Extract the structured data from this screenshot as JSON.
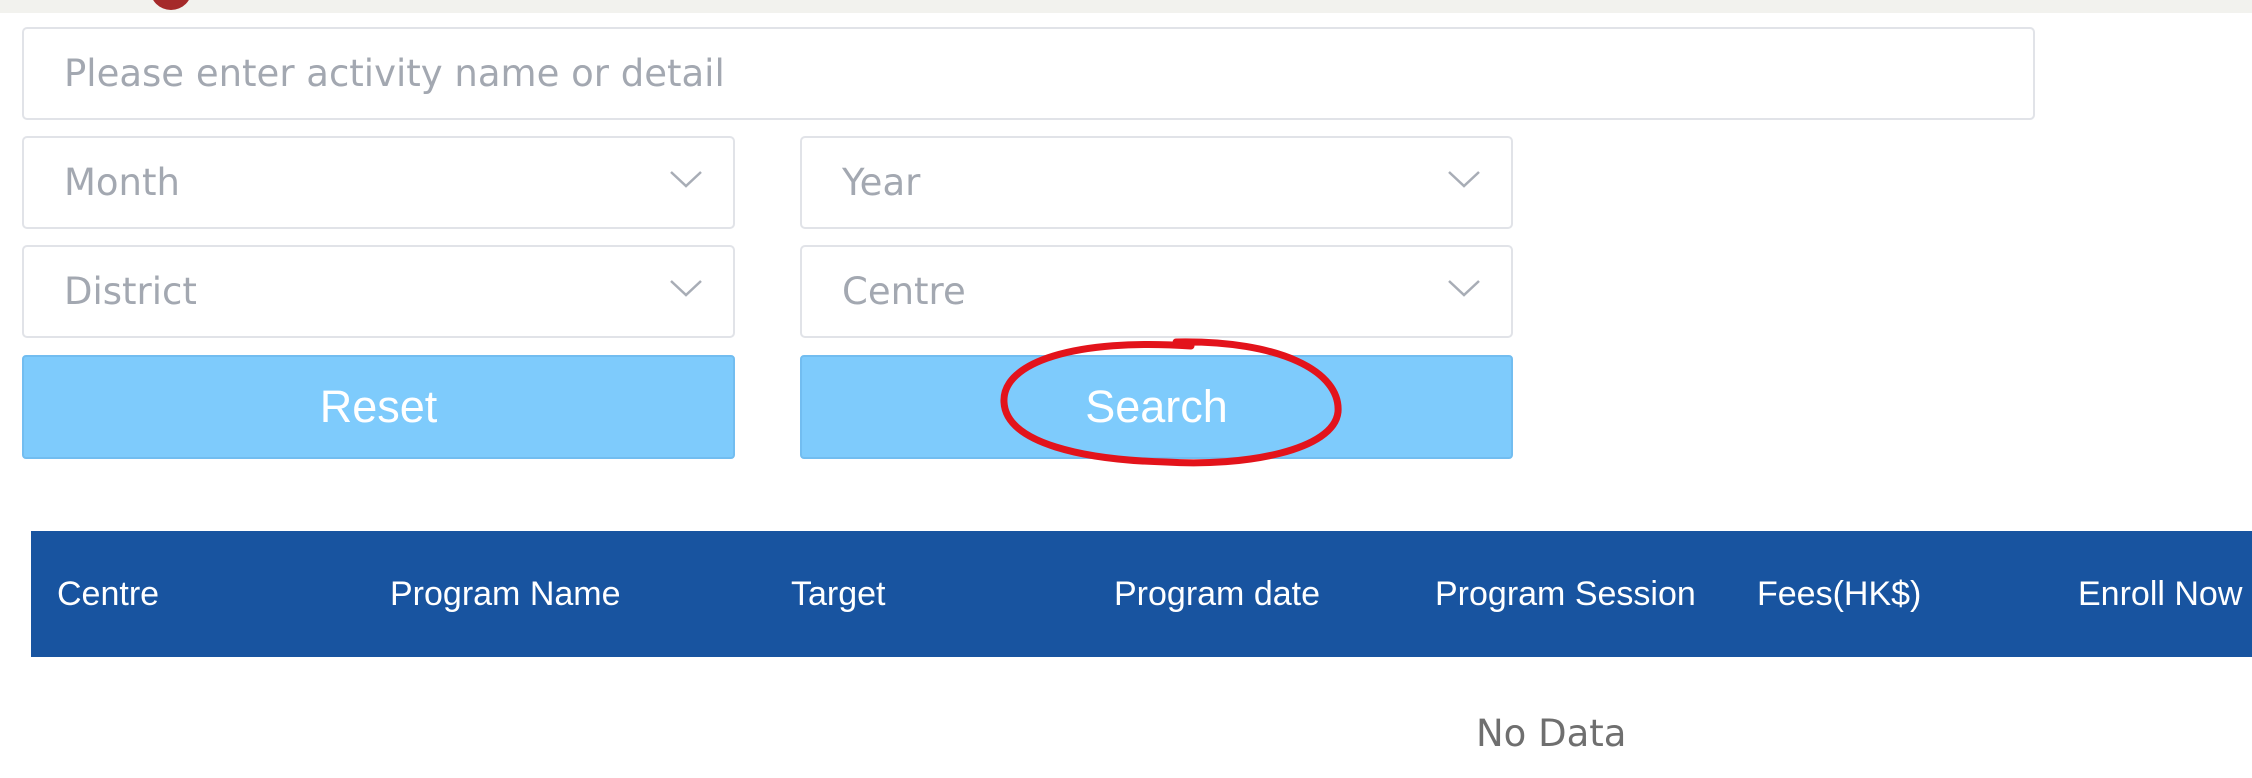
{
  "search": {
    "placeholder": "Please enter activity name or detail"
  },
  "filters": {
    "month_placeholder": "Month",
    "year_placeholder": "Year",
    "district_placeholder": "District",
    "centre_placeholder": "Centre"
  },
  "buttons": {
    "reset_label": "Reset",
    "search_label": "Search"
  },
  "table": {
    "columns": [
      "Centre",
      "Program Name",
      "Target",
      "Program date",
      "Program Session",
      "Fees(HK$)",
      "Enroll Now"
    ],
    "rows": [],
    "empty_text": "No Data"
  },
  "colors": {
    "header_bg": "#1854a0",
    "button_bg": "#7ecbfc",
    "annotation": "#e3131b"
  },
  "icons": {
    "select_arrow": "chevron-down-icon",
    "annotation": "red-circle-annotation"
  }
}
